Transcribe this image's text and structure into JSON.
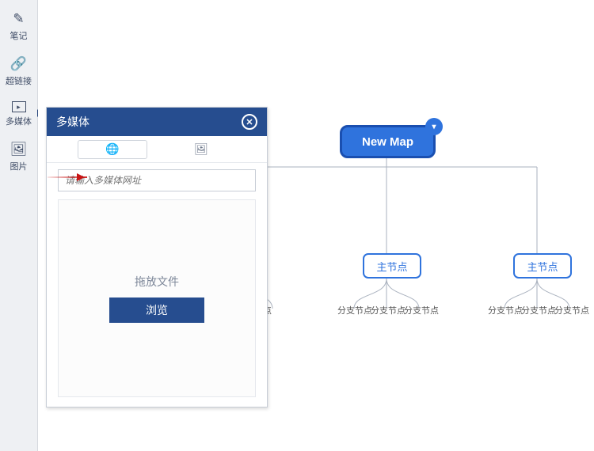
{
  "sidebar": {
    "items": [
      {
        "label": "笔记",
        "icon": "✎"
      },
      {
        "label": "超链接",
        "icon": "🔗"
      },
      {
        "label": "多媒体",
        "icon": "▸"
      },
      {
        "label": "图片",
        "icon": "🖼"
      }
    ],
    "active_index": 2
  },
  "panel": {
    "title": "多媒体",
    "tabs": {
      "url_icon": "🌐",
      "img_icon": "🖼"
    },
    "url_placeholder": "请输入多媒体网址",
    "drop_text": "拖放文件",
    "browse_label": "浏览"
  },
  "mindmap": {
    "root": "New Map",
    "main_node": "主节点",
    "branch_node": "分支节点"
  }
}
